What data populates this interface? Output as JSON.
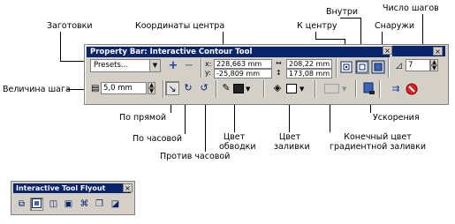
{
  "annotations": {
    "number_of_steps": "Число шагов",
    "inside": "Внутри",
    "outside": "Снаружи",
    "to_center": "К центру",
    "center_coords": "Координаты центра",
    "presets": "Заготовки",
    "step_size": "Величина шага",
    "straight": "По прямой",
    "clockwise": "По часовой",
    "counterclockwise": "Против часовой",
    "outline_color": "Цвет обводки",
    "fill_color": "Цвет заливки",
    "end_gradient": "Конечный цвет градиентной заливки",
    "acceleration": "Ускорения"
  },
  "property_bar": {
    "title": "Property Bar: Interactive Contour Tool",
    "close_glyph": "×",
    "presets_value": "Presets...",
    "x_label": "x:",
    "y_label": "y:",
    "x_value": "228,663 mm",
    "y_value": "-25,809 mm",
    "width_value": "208,22 mm",
    "height_value": "173,08 mm",
    "steps_value": "7",
    "step_offset_value": "5,0 mm",
    "add_glyph": "+",
    "remove_glyph": "−"
  },
  "flyout": {
    "title": "Interactive Tool Flyout",
    "close_glyph": "×"
  },
  "colors": {
    "title_bar": "#0a246a",
    "toolbar_bg": "#d4d0c8",
    "outline_swatch": "#222222",
    "fill_swatch": "#ffffff"
  }
}
